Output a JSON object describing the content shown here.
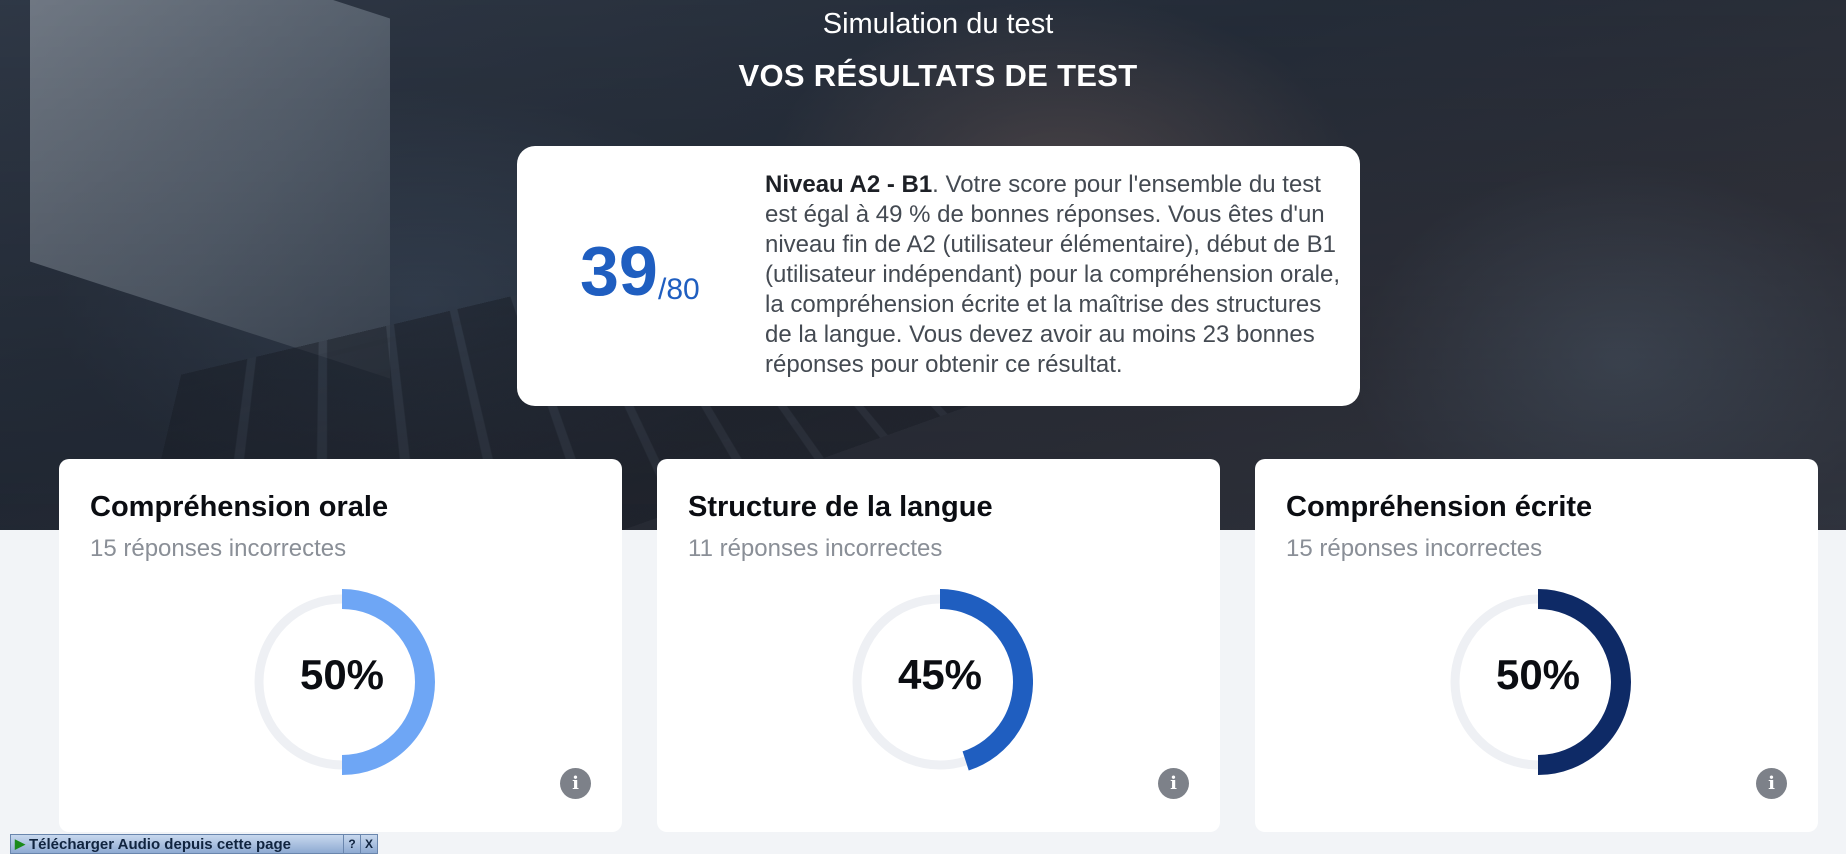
{
  "header": {
    "title": "Simulation du test",
    "subtitle": "VOS RÉSULTATS DE TEST"
  },
  "score": {
    "value": "39",
    "total": "/80",
    "level": "Niveau A2 - B1",
    "description": ". Votre score pour l'ensemble du test est égal à 49 % de bonnes réponses. Vous êtes d'un niveau fin de A2 (utilisateur élémentaire), début de B1 (utilisateur indépendant) pour la compréhension orale, la compréhension écrite et la maîtrise des structures de la langue. Vous devez avoir au moins 23 bonnes réponses pour obtenir ce résultat."
  },
  "skills": [
    {
      "title": "Compréhension orale",
      "subtitle": "15 réponses incorrectes",
      "percent_label": "50%",
      "percent": 50,
      "color": "#6ea6f5"
    },
    {
      "title": "Structure de la langue",
      "subtitle": "11 réponses incorrectes",
      "percent_label": "45%",
      "percent": 45,
      "color": "#1f5ec0"
    },
    {
      "title": "Compréhension écrite",
      "subtitle": "15 réponses incorrectes",
      "percent_label": "50%",
      "percent": 50,
      "color": "#0e2a66"
    }
  ],
  "colors": {
    "accent": "#1f5ec0",
    "ring_track": "#eef0f4",
    "info_icon_bg": "#7d8189"
  },
  "icons": {
    "info": "info-icon",
    "play": "play-icon",
    "help": "help-icon",
    "close": "close-icon"
  },
  "audio_toolbar": {
    "label": "Télécharger Audio depuis cette page",
    "help": "?",
    "close": "X"
  }
}
